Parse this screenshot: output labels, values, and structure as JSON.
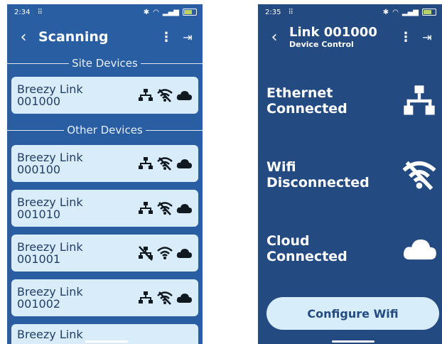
{
  "scan_screen": {
    "status_time": "2:34",
    "status_signal": "⁴ᴳ",
    "title": "Scanning",
    "section_site": "Site Devices",
    "section_other": "Other Devices",
    "devices": [
      {
        "name": "Breezy Link",
        "id": "001000",
        "ethernet": "connected",
        "wifi": "disconnected",
        "cloud": "connected"
      },
      {
        "name": "Breezy Link",
        "id": "000100",
        "ethernet": "connected",
        "wifi": "disconnected",
        "cloud": "connected"
      },
      {
        "name": "Breezy Link",
        "id": "001010",
        "ethernet": "connected",
        "wifi": "disconnected",
        "cloud": "connected"
      },
      {
        "name": "Breezy Link",
        "id": "001001",
        "ethernet": "disconnected",
        "wifi": "connected",
        "cloud": "connected"
      },
      {
        "name": "Breezy Link",
        "id": "001002",
        "ethernet": "connected",
        "wifi": "disconnected",
        "cloud": "connected"
      },
      {
        "name": "Breezy Link",
        "id": "",
        "ethernet": "",
        "wifi": "",
        "cloud": ""
      }
    ]
  },
  "control_screen": {
    "status_time": "2:35",
    "title": "Link 001000",
    "subtitle": "Device Control",
    "ethernet_label": "Ethernet",
    "ethernet_status": "Connected",
    "wifi_label": "Wifi",
    "wifi_status": "Disconnected",
    "cloud_label": "Cloud",
    "cloud_status": "Connected",
    "configure_button": "Configure Wifi"
  },
  "colors": {
    "scan_background": "#2a5ea3",
    "control_background": "#244a82",
    "card_background": "#d8edf9",
    "icon_dark": "#101820"
  }
}
